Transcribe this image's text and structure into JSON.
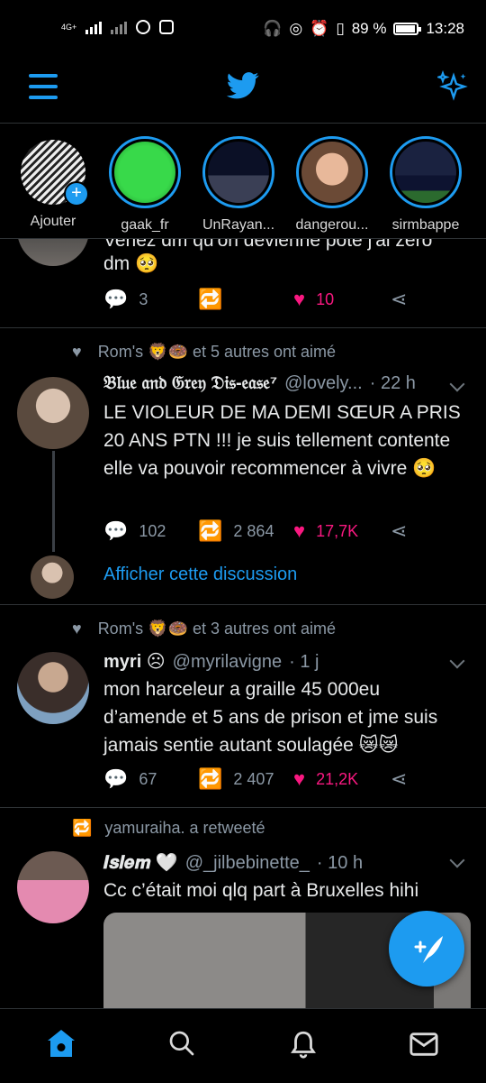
{
  "status_bar": {
    "network": "4G+",
    "battery": "89 %",
    "time": "13:28"
  },
  "header": {
    "menu_icon": "hamburger-icon",
    "logo_icon": "twitter-bird-icon",
    "sparkle_icon": "sparkle-icon"
  },
  "fleets": [
    {
      "label": "Ajouter",
      "own": true
    },
    {
      "label": "gaak_fr"
    },
    {
      "label": "UnRayan..."
    },
    {
      "label": "dangerou..."
    },
    {
      "label": "sirmbappe"
    }
  ],
  "tweet0": {
    "partial_text": "Venez dm qu'on devienne pote j'ai zero",
    "text_line2": "dm 🥺",
    "replies": "3",
    "likes": "10"
  },
  "tweet1": {
    "context": "Rom's 🦁🍩 et 5 autres ont aimé",
    "name": "𝔅𝔩𝔲𝔢 𝔞𝔫𝔡 𝔊𝔯𝔢𝔶 𝔇𝔦𝔰-𝔢𝔞𝔰𝔢⁷",
    "handle": "@lovely...",
    "time": "· 22 h",
    "text": "LE VIOLEUR DE MA DEMI SŒUR A PRIS 20 ANS PTN !!! je suis tellement contente elle va pouvoir recommencer à vivre 🥺",
    "replies": "102",
    "retweets": "2 864",
    "likes": "17,7K",
    "show_thread": "Afficher cette discussion"
  },
  "tweet2": {
    "context": "Rom's 🦁🍩 et 3 autres ont aimé",
    "name": "myri ☹",
    "handle": "@myrilavigne",
    "time": "· 1 j",
    "text": "mon harceleur a graille 45 000eu d’amende et 5 ans de prison et jme suis jamais sentie autant soulagée 😿😿",
    "replies": "67",
    "retweets": "2 407",
    "likes": "21,2K"
  },
  "tweet3": {
    "context": "yamuraiha. a retweeté",
    "name": "𝑰𝒔𝒍𝒆𝒎 🤍",
    "handle": "@_jilbebinette_",
    "time": "· 10 h",
    "text": "Cc c’était moi qlq part à Bruxelles hihi"
  },
  "colors": {
    "accent": "#1d9bf0",
    "like": "#f91880",
    "background": "#000000",
    "muted": "#8b98a5"
  },
  "bottom_nav": [
    "home-icon",
    "search-icon",
    "notifications-icon",
    "messages-icon"
  ]
}
